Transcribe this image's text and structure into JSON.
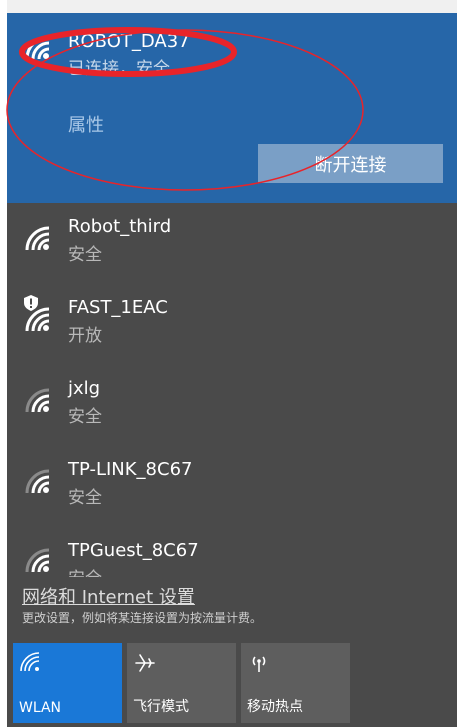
{
  "connected_network": {
    "name": "ROBOT_DA37",
    "status": "已连接，安全",
    "properties_label": "属性",
    "disconnect_label": "断开连接"
  },
  "networks": [
    {
      "name": "Robot_third",
      "status": "安全"
    },
    {
      "name": "FAST_1EAC",
      "status": "开放"
    },
    {
      "name": "jxlg",
      "status": "安全"
    },
    {
      "name": "TP-LINK_8C67",
      "status": "安全"
    },
    {
      "name": "TPGuest_8C67",
      "status": "安全"
    }
  ],
  "settings": {
    "link_label": "网络和 Internet 设置",
    "description": "更改设置，例如将某连接设置为按流量计费。"
  },
  "quick_actions": [
    {
      "label": "WLAN",
      "icon": "wifi-icon",
      "active": true
    },
    {
      "label": "飞行模式",
      "icon": "airplane-icon",
      "active": false
    },
    {
      "label": "移动热点",
      "icon": "hotspot-icon",
      "active": false
    }
  ],
  "colors": {
    "accent": "#1a78d7",
    "connected_bg": "#2666a8",
    "panel_bg": "#4a4a4a",
    "annotation_red": "#e8242a"
  }
}
